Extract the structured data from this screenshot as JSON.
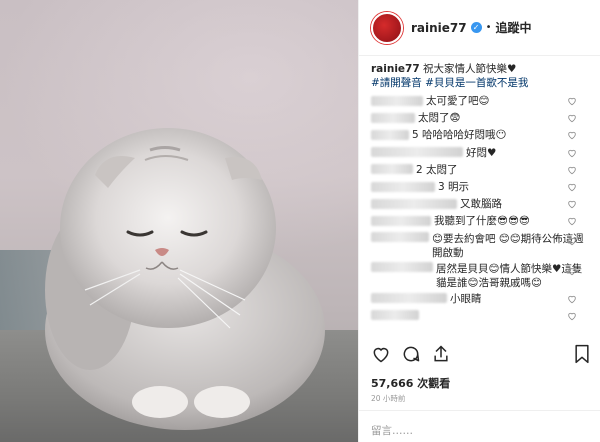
{
  "header": {
    "username": "rainie77",
    "follow_status": "追蹤中",
    "dot": "•"
  },
  "caption": {
    "username": "rainie77",
    "text": "祝大家情人節快樂♥",
    "hashtags": "#請開聲音 #貝貝是一首歌不是我"
  },
  "comments": [
    {
      "text": "太可愛了吧😊",
      "blur_width": 52,
      "multiline": false
    },
    {
      "text": "太悶了😨",
      "blur_width": 44,
      "multiline": false
    },
    {
      "text": "5 哈哈哈哈好悶哦😶",
      "blur_width": 38,
      "multiline": false
    },
    {
      "text": "好悶♥",
      "blur_width": 92,
      "multiline": false
    },
    {
      "text": "2 太悶了",
      "blur_width": 42,
      "multiline": false
    },
    {
      "text": "3 明示",
      "blur_width": 64,
      "multiline": false
    },
    {
      "text": "又敢腦路",
      "blur_width": 86,
      "multiline": false
    },
    {
      "text": "我聽到了什麼😎😎😎",
      "blur_width": 60,
      "multiline": false
    },
    {
      "text": "😊要去約會吧 😊😊期待公佈這週開啟動",
      "blur_width": 58,
      "multiline": true
    },
    {
      "text": "居然是貝貝😊情人節快樂♥這隻貓是誰😊浩哥親戚嗎😊",
      "blur_width": 62,
      "multiline": true
    },
    {
      "text": "小眼睛",
      "blur_width": 76,
      "multiline": false
    },
    {
      "text": "",
      "blur_width": 48,
      "multiline": false
    }
  ],
  "actions": {
    "like": "heart-icon",
    "comment": "comment-icon",
    "share": "share-icon",
    "save": "bookmark-icon"
  },
  "stats": {
    "views": "57,666 次觀看",
    "time": "20 小時前"
  },
  "add_comment": {
    "placeholder": "留言……"
  },
  "colors": {
    "accent": "#3897f0",
    "hashtag": "#003569",
    "muted": "#999999"
  }
}
